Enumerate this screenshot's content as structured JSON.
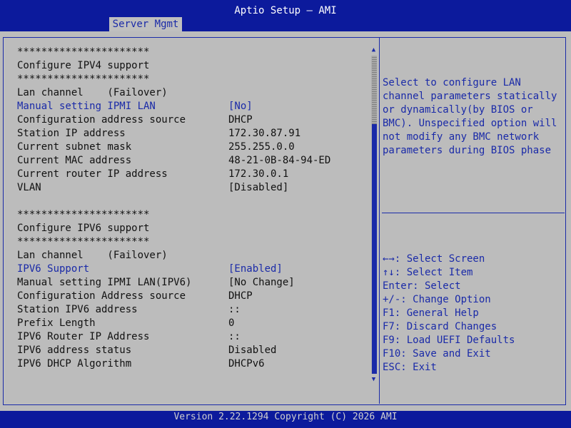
{
  "header": {
    "title": "Aptio Setup – AMI",
    "tab": "Server Mgmt"
  },
  "ipv4": {
    "stars_top": "**********************",
    "heading": "Configure IPV4 support",
    "stars_bottom": "**********************",
    "lan_channel": "Lan channel    (Failover)",
    "manual_label": "Manual setting IPMI LAN",
    "manual_value": "[No]",
    "src_label": "Configuration address source",
    "src_value": "DHCP",
    "ip_label": "Station IP address",
    "ip_value": "172.30.87.91",
    "mask_label": "Current subnet mask",
    "mask_value": "255.255.0.0",
    "mac_label": "Current MAC address",
    "mac_value": "48-21-0B-84-94-ED",
    "router_label": "Current router IP address",
    "router_value": "172.30.0.1",
    "vlan_label": "VLAN",
    "vlan_value": "[Disabled]"
  },
  "ipv6": {
    "stars_top": "**********************",
    "heading": "Configure IPV6 support",
    "stars_bottom": "**********************",
    "lan_channel": "Lan channel    (Failover)",
    "support_label": "IPV6 Support",
    "support_value": "[Enabled]",
    "manual_label": "Manual setting IPMI LAN(IPV6)",
    "manual_value": "[No Change]",
    "src_label": "Configuration Address source",
    "src_value": "DHCP",
    "addr_label": "Station IPV6 address",
    "addr_value": "::",
    "prefix_label": "Prefix Length",
    "prefix_value": "0",
    "router_label": "IPV6 Router IP Address",
    "router_value": "::",
    "status_label": "IPV6 address status",
    "status_value": "Disabled",
    "dhcp_label": "IPV6 DHCP Algorithm",
    "dhcp_value": "DHCPv6"
  },
  "help": {
    "lines": [
      "Select to configure LAN",
      "channel parameters statically",
      "or dynamically(by BIOS or",
      "BMC). Unspecified option will",
      "not modify any BMC network",
      "parameters during BIOS phase"
    ]
  },
  "keys": {
    "lines": [
      "←→: Select Screen",
      "↑↓: Select Item",
      "Enter: Select",
      "+/-: Change Option",
      "F1: General Help",
      "F7: Discard Changes",
      "F9: Load UEFI Defaults",
      "F10: Save and Exit",
      "ESC: Exit"
    ]
  },
  "footer": {
    "text": "Version 2.22.1294 Copyright (C) 2026 AMI"
  },
  "scrollbar": {
    "position": 0.21
  },
  "colors": {
    "background": "#0c1a9c",
    "panel": "#bcbcbc",
    "accent": "#1a2aa8",
    "text": "#111111"
  }
}
